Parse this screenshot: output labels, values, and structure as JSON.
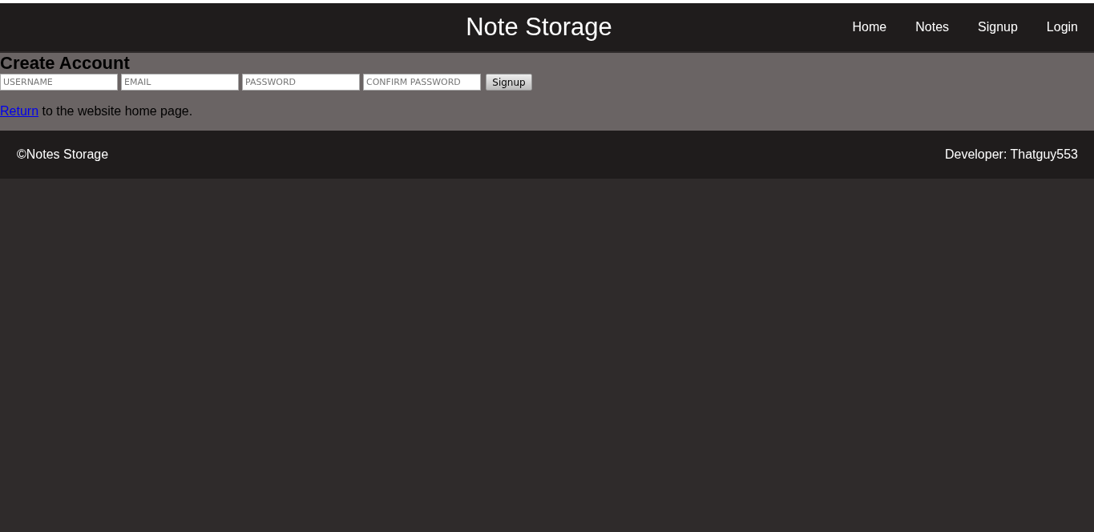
{
  "header": {
    "title": "Note Storage",
    "nav": [
      "Home",
      "Notes",
      "Signup",
      "Login"
    ]
  },
  "form": {
    "heading": "Create Account",
    "fields": [
      {
        "placeholder": "USERNAME"
      },
      {
        "placeholder": "EMAIL"
      },
      {
        "placeholder": "PASSWORD"
      },
      {
        "placeholder": "CONFIRM PASSWORD"
      }
    ],
    "button": "Signup"
  },
  "return_line": {
    "link": "Return",
    "text": " to the website home page."
  },
  "footer": {
    "copyright": "©Notes Storage",
    "developer": "Developer: Thatguy553"
  }
}
